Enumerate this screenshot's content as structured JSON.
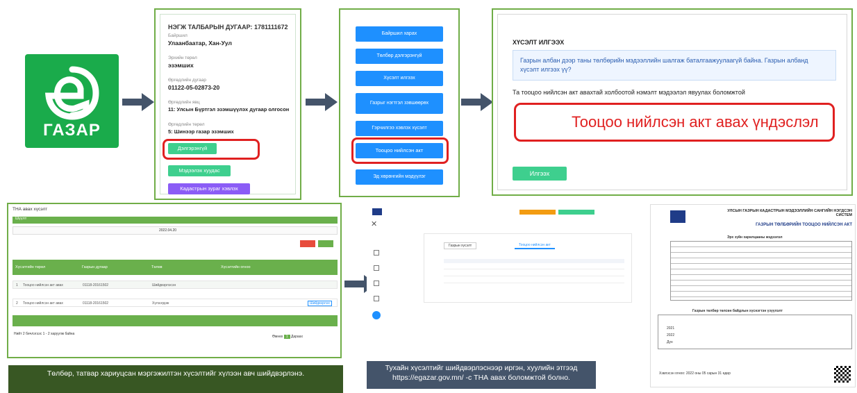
{
  "logo": {
    "text": "ГАЗАР",
    "icon": "e-leaf-icon",
    "color": "#1aab4b"
  },
  "panel_details": {
    "title": "НЭГЖ ТАЛБАРЫН ДУГААР: 1781111672",
    "fields": [
      {
        "label": "Байршил",
        "value": "Улаанбаатар, Хан-Уул"
      },
      {
        "label": "Эрхийн төрөл",
        "value": "эзэмших"
      },
      {
        "label": "Өргөдлийн дугаар",
        "value": "01122-05-02873-20"
      },
      {
        "label": "Өргөдлийн явц",
        "value": "11: Улсын Бүртгэл эзэмшүүлэх дугаар олгосон"
      },
      {
        "label": "Өргөдлийн төрөл",
        "value": "5: Шинээр газар эзэмших"
      }
    ],
    "buttons": {
      "details": "Дэлгэрэнгүй",
      "documents": "Мэдээлэх хуудас",
      "cadastral": "Кадастрын зураг хэвлэх"
    }
  },
  "panel_menu": {
    "buttons": [
      "Байршил харах",
      "Төлбөр дэлгэрэнгүй",
      "Хүсэлт илгээх",
      "Газрыг нэгтгэл зэвшөөрөх",
      "Гэрчилгээ хэвлэх хүсэлт",
      "Тооцоо нийлсэн акт",
      "Эд хөрөнгийн мэдүүлэг"
    ]
  },
  "panel_request": {
    "header": "ХҮСЭЛТ ИЛГЭЭХ",
    "alert": "Газрын албан дээр таны төлбөрийн мэдээллийн шалгаж баталгаажуулаагүй байна. Газрын албанд хүсэлт илгээх үү?",
    "instruction": "Та тооцоо нийлсэн акт авахтай холбоотой нэмэлт мэдээлэл явуулах боломжтой",
    "textarea_value": "Тооцоо нийлсэн акт авах үндэслэл",
    "send_label": "Илгээх"
  },
  "panel_list": {
    "tab": "ТНА авах хүсэлт",
    "filter_label": "Шүүлт",
    "date": "2022.04.20",
    "header": [
      "№",
      "Хүсэлтийн төрөл",
      "Хүсэлт гаргасан",
      "Газрын дугаар",
      "Нэгж талбарын дугаар",
      "Хэргийн",
      "Төлөв",
      "Нэмэлт тайлбар",
      "Хүсэлтийн огноо",
      "Үйлдэл"
    ],
    "rows": [
      [
        "1",
        "Тооцоо нийлсэн акт авах",
        "О.Оюунбилэг",
        "01118-20161502",
        "1802007006",
        "Бат",
        "Шийдвэрлэсэн",
        "Хүчин",
        "2022.04.20",
        ""
      ],
      [
        "2",
        "Тооцоо нийлсэн акт авах",
        "О.Оюунбилэг",
        "01118-20161502",
        "1802007006",
        "Бат",
        "Хүлээгдэж",
        "",
        "2022.04.21",
        "Шийдвэрлэх"
      ]
    ],
    "footer": "Нийт 2 бичлэгээс 1 - 2 харуулж байна",
    "pager": [
      "Өмнөх",
      "1",
      "Дараах"
    ],
    "caption": "Төлбөр, татвар хариуцсан мэргэжилтэн хүсэлтийг хүлээн авч шийдвэрлэнэ."
  },
  "panel_portal": {
    "tabs": [
      "Газрын хүсэлт",
      "Тооцоо нийлсэн акт"
    ],
    "caption": "Тухайн хүсэлтийг шийдвэрлэснээр иргэн, хуулийн этгээд https://egazar.gov.mn/ -с ТНА авах боломжтой болно."
  },
  "panel_doc": {
    "org": "УЛСЫН ГАЗРЫН КАДАСТРЫН МЭДЭЭЛЛИЙН САНГИЙН НЭГДСЭН СИСТЕМ",
    "title": "ГАЗРЫН ТӨЛБӨРИЙН ТООЦОО НИЙЛСЭН АКТ",
    "section": "Эрх зүйн харилцааны мэдээлэл",
    "table_title": "Газрын төлбөр төлсөн байдлын хүснэгтэн үзүүлэлт",
    "years": [
      "2021",
      "2022",
      "Дүн"
    ],
    "footer": "Хэвлэсэн огноо: 2022 оны 05 сарын 31 өдөр"
  }
}
